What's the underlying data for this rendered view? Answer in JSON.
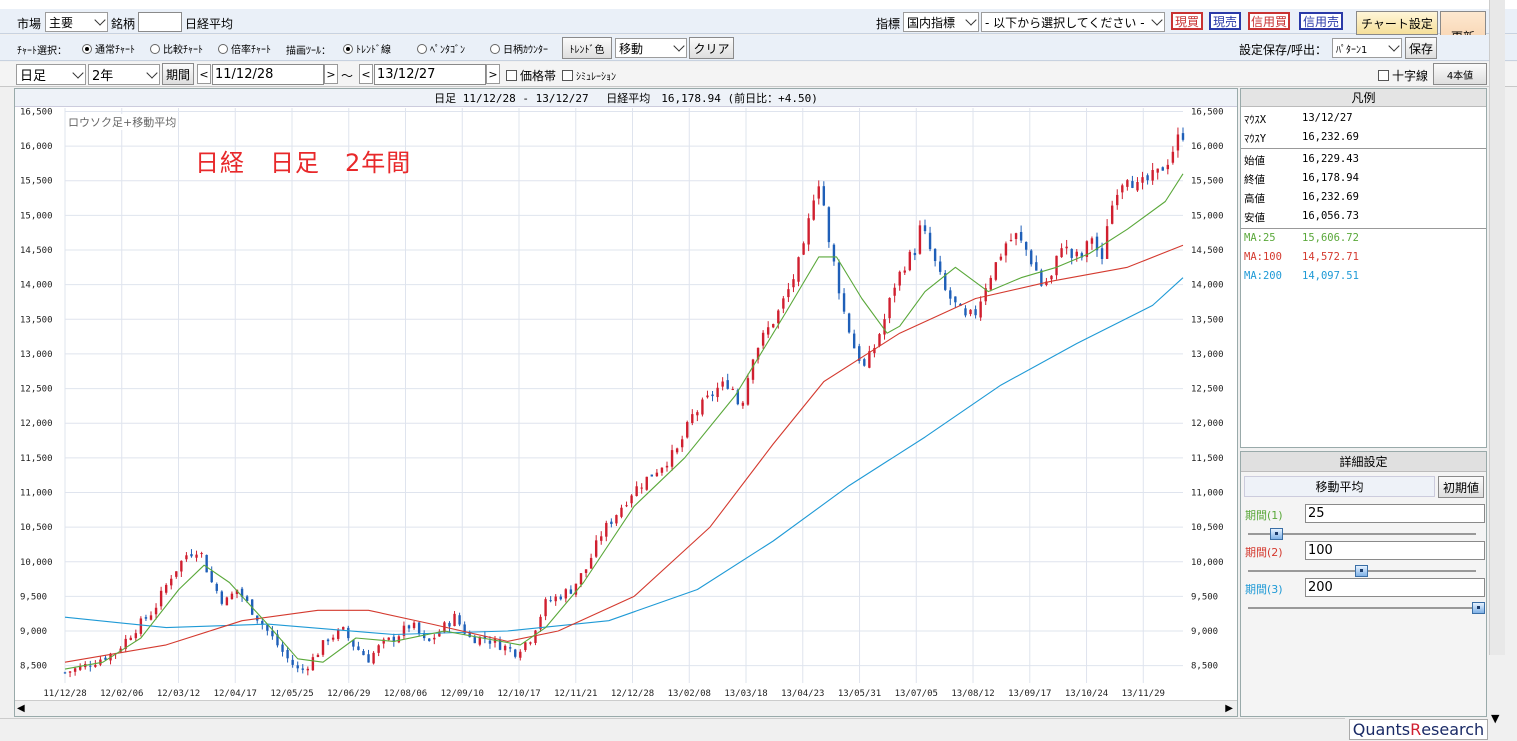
{
  "top": {
    "market_label": "市場",
    "market_value": "主要",
    "symbol_label": "銘柄",
    "symbol_value": "",
    "symbol_name": "日経平均",
    "indicator_label": "指標",
    "indicator_value": "国内指標",
    "indicator_select": "- 以下から選択してください -",
    "buy_label": "現買",
    "sell_label": "現売",
    "margin_buy_label": "信用買",
    "margin_sell_label": "信用売",
    "chart_settings_label": "チャート設定",
    "refresh_label": "更新"
  },
  "row2": {
    "chart_select_label": "ﾁｬｰﾄ選択：",
    "normal_chart": "通常ﾁｬｰﾄ",
    "compare_chart": "比較ﾁｬｰﾄ",
    "ratio_chart": "倍率ﾁｬｰﾄ",
    "draw_tool_label": "描画ﾂｰﾙ：",
    "trend_line": "ﾄﾚﾝﾄﾞ線",
    "pentagon": "ﾍﾟﾝﾀｺﾞﾝ",
    "day_counter": "日柄ｶｳﾝﾀｰ",
    "trend_color_label": "ﾄﾚﾝﾄﾞ色",
    "move_value": "移動",
    "clear_label": "クリア",
    "save_load_label": "設定保存/呼出：",
    "pattern_value": "ﾊﾟﾀｰﾝ1",
    "save_label": "保存"
  },
  "row3": {
    "period_type": "日足",
    "span": "2年",
    "period_btn": "期間",
    "from_date": "11/12/28",
    "tilde": "〜",
    "to_date": "13/12/27",
    "price_band": "価格帯",
    "simulation": "ｼﾐｭﾚｰｼｮﾝ",
    "crosshair": "十字線",
    "four_values": "4本値"
  },
  "chart_header": "日足 11/12/28 - 13/12/27　 日経平均　16,178.94 (前日比：+4.50)",
  "annotation": "ロウソク足+移動平均",
  "overlay_text": "日経　日足　2年間",
  "legend": {
    "title": "凡例",
    "mouse_x_label": "ﾏｳｽX",
    "mouse_x": "13/12/27",
    "mouse_y_label": "ﾏｳｽY",
    "mouse_y": "16,232.69",
    "open_label": "始値",
    "open": "16,229.43",
    "close_label": "終値",
    "close": "16,178.94",
    "high_label": "高値",
    "high": "16,232.69",
    "low_label": "安値",
    "low": "16,056.73",
    "ma25_label": "MA:25",
    "ma25": "15,606.72",
    "ma100_label": "MA:100",
    "ma100": "14,572.71",
    "ma200_label": "MA:200",
    "ma200": "14,097.51"
  },
  "detail": {
    "title": "詳細設定",
    "ma_label": "移動平均",
    "reset_label": "初期値",
    "p1_label": "期間(1)",
    "p1": "25",
    "p2_label": "期間(2)",
    "p2": "100",
    "p3_label": "期間(3)",
    "p3": "200"
  },
  "logo": {
    "q": "Q",
    "uants": "uants ",
    "r": "R",
    "esearch": "esearch"
  },
  "colors": {
    "up": "#d01f2f",
    "down": "#1f5fb8",
    "ma25": "#5aa83a",
    "ma100": "#d43a2f",
    "ma200": "#1f9ad6",
    "grid": "#dfe4ee"
  },
  "chart_data": {
    "type": "candlestick",
    "title": "日足 11/12/28 - 13/12/27 日経平均 16,178.94 (前日比：+4.50)",
    "ylim": [
      8250,
      16550
    ],
    "y_ticks": [
      "16,500",
      "16,000",
      "15,500",
      "15,000",
      "14,500",
      "14,000",
      "13,500",
      "13,000",
      "12,500",
      "12,000",
      "11,500",
      "11,000",
      "10,500",
      "10,000",
      "9,500",
      "9,000",
      "8,500"
    ],
    "y_tick_values": [
      16500,
      16000,
      15500,
      15000,
      14500,
      14000,
      13500,
      13000,
      12500,
      12000,
      11500,
      11000,
      10500,
      10000,
      9500,
      9000,
      8500
    ],
    "x_ticks": [
      "11/12/28",
      "12/02/06",
      "12/03/12",
      "12/04/17",
      "12/05/25",
      "12/06/29",
      "12/08/06",
      "12/09/10",
      "12/10/17",
      "12/11/21",
      "12/12/28",
      "13/02/08",
      "13/03/18",
      "13/04/23",
      "13/05/31",
      "13/07/05",
      "13/08/12",
      "13/09/17",
      "13/10/24",
      "13/11/29"
    ],
    "close_path": [
      [
        0,
        8400
      ],
      [
        8,
        8500
      ],
      [
        20,
        8700
      ],
      [
        27,
        9000
      ],
      [
        35,
        9300
      ],
      [
        42,
        9800
      ],
      [
        48,
        10100
      ],
      [
        53,
        10200
      ],
      [
        58,
        9700
      ],
      [
        63,
        9400
      ],
      [
        68,
        9600
      ],
      [
        76,
        9200
      ],
      [
        82,
        8900
      ],
      [
        88,
        8600
      ],
      [
        93,
        8400
      ],
      [
        98,
        8600
      ],
      [
        104,
        8900
      ],
      [
        110,
        9000
      ],
      [
        114,
        8800
      ],
      [
        120,
        8600
      ],
      [
        125,
        8800
      ],
      [
        130,
        8900
      ],
      [
        137,
        9100
      ],
      [
        143,
        8800
      ],
      [
        148,
        9000
      ],
      [
        154,
        9200
      ],
      [
        160,
        8900
      ],
      [
        166,
        8900
      ],
      [
        172,
        8800
      ],
      [
        178,
        8700
      ],
      [
        184,
        8900
      ],
      [
        190,
        9400
      ],
      [
        195,
        9500
      ],
      [
        200,
        9600
      ],
      [
        206,
        9900
      ],
      [
        212,
        10400
      ],
      [
        218,
        10700
      ],
      [
        224,
        11000
      ],
      [
        230,
        11200
      ],
      [
        236,
        11400
      ],
      [
        242,
        11600
      ],
      [
        248,
        12100
      ],
      [
        253,
        12300
      ],
      [
        258,
        12500
      ],
      [
        263,
        12600
      ],
      [
        267,
        12200
      ],
      [
        272,
        13000
      ],
      [
        277,
        13300
      ],
      [
        282,
        13600
      ],
      [
        287,
        14000
      ],
      [
        292,
        14500
      ],
      [
        296,
        15300
      ],
      [
        299,
        15600
      ],
      [
        301,
        14700
      ],
      [
        304,
        14300
      ],
      [
        308,
        13600
      ],
      [
        312,
        13100
      ],
      [
        316,
        12800
      ],
      [
        320,
        13100
      ],
      [
        324,
        13500
      ],
      [
        328,
        14000
      ],
      [
        332,
        14300
      ],
      [
        336,
        14500
      ],
      [
        338,
        14800
      ],
      [
        340,
        14700
      ],
      [
        344,
        14300
      ],
      [
        348,
        13900
      ],
      [
        352,
        13700
      ],
      [
        356,
        13500
      ],
      [
        360,
        13600
      ],
      [
        364,
        14000
      ],
      [
        368,
        14300
      ],
      [
        372,
        14600
      ],
      [
        376,
        14700
      ],
      [
        380,
        14500
      ],
      [
        384,
        14200
      ],
      [
        386,
        14000
      ],
      [
        390,
        14100
      ],
      [
        394,
        14600
      ],
      [
        398,
        14400
      ],
      [
        402,
        14400
      ],
      [
        406,
        14700
      ],
      [
        410,
        14300
      ],
      [
        412,
        14900
      ],
      [
        416,
        15400
      ],
      [
        420,
        15600
      ],
      [
        424,
        15400
      ],
      [
        428,
        15500
      ],
      [
        432,
        15600
      ],
      [
        436,
        15800
      ],
      [
        440,
        16100
      ],
      [
        442,
        16180
      ]
    ],
    "ma25_path": [
      [
        0,
        8450
      ],
      [
        15,
        8550
      ],
      [
        30,
        8900
      ],
      [
        45,
        9600
      ],
      [
        55,
        9950
      ],
      [
        65,
        9700
      ],
      [
        80,
        9100
      ],
      [
        92,
        8600
      ],
      [
        102,
        8550
      ],
      [
        115,
        8900
      ],
      [
        130,
        8850
      ],
      [
        150,
        9000
      ],
      [
        165,
        8900
      ],
      [
        180,
        8800
      ],
      [
        190,
        9050
      ],
      [
        205,
        9700
      ],
      [
        225,
        10800
      ],
      [
        245,
        11500
      ],
      [
        265,
        12400
      ],
      [
        285,
        13600
      ],
      [
        298,
        14400
      ],
      [
        305,
        14400
      ],
      [
        315,
        13800
      ],
      [
        325,
        13300
      ],
      [
        330,
        13400
      ],
      [
        340,
        13900
      ],
      [
        352,
        14250
      ],
      [
        365,
        13900
      ],
      [
        378,
        14100
      ],
      [
        392,
        14250
      ],
      [
        405,
        14450
      ],
      [
        420,
        14800
      ],
      [
        435,
        15200
      ],
      [
        442,
        15600
      ]
    ],
    "ma100_path": [
      [
        0,
        8550
      ],
      [
        40,
        8800
      ],
      [
        70,
        9150
      ],
      [
        100,
        9300
      ],
      [
        120,
        9300
      ],
      [
        145,
        9100
      ],
      [
        175,
        8850
      ],
      [
        195,
        9000
      ],
      [
        225,
        9500
      ],
      [
        255,
        10500
      ],
      [
        280,
        11700
      ],
      [
        300,
        12600
      ],
      [
        330,
        13300
      ],
      [
        360,
        13800
      ],
      [
        390,
        14050
      ],
      [
        420,
        14250
      ],
      [
        442,
        14570
      ]
    ],
    "ma200_path": [
      [
        0,
        9200
      ],
      [
        40,
        9050
      ],
      [
        80,
        9100
      ],
      [
        130,
        8950
      ],
      [
        175,
        9000
      ],
      [
        215,
        9150
      ],
      [
        250,
        9600
      ],
      [
        280,
        10300
      ],
      [
        310,
        11100
      ],
      [
        340,
        11800
      ],
      [
        370,
        12550
      ],
      [
        400,
        13150
      ],
      [
        430,
        13700
      ],
      [
        442,
        14100
      ]
    ]
  }
}
